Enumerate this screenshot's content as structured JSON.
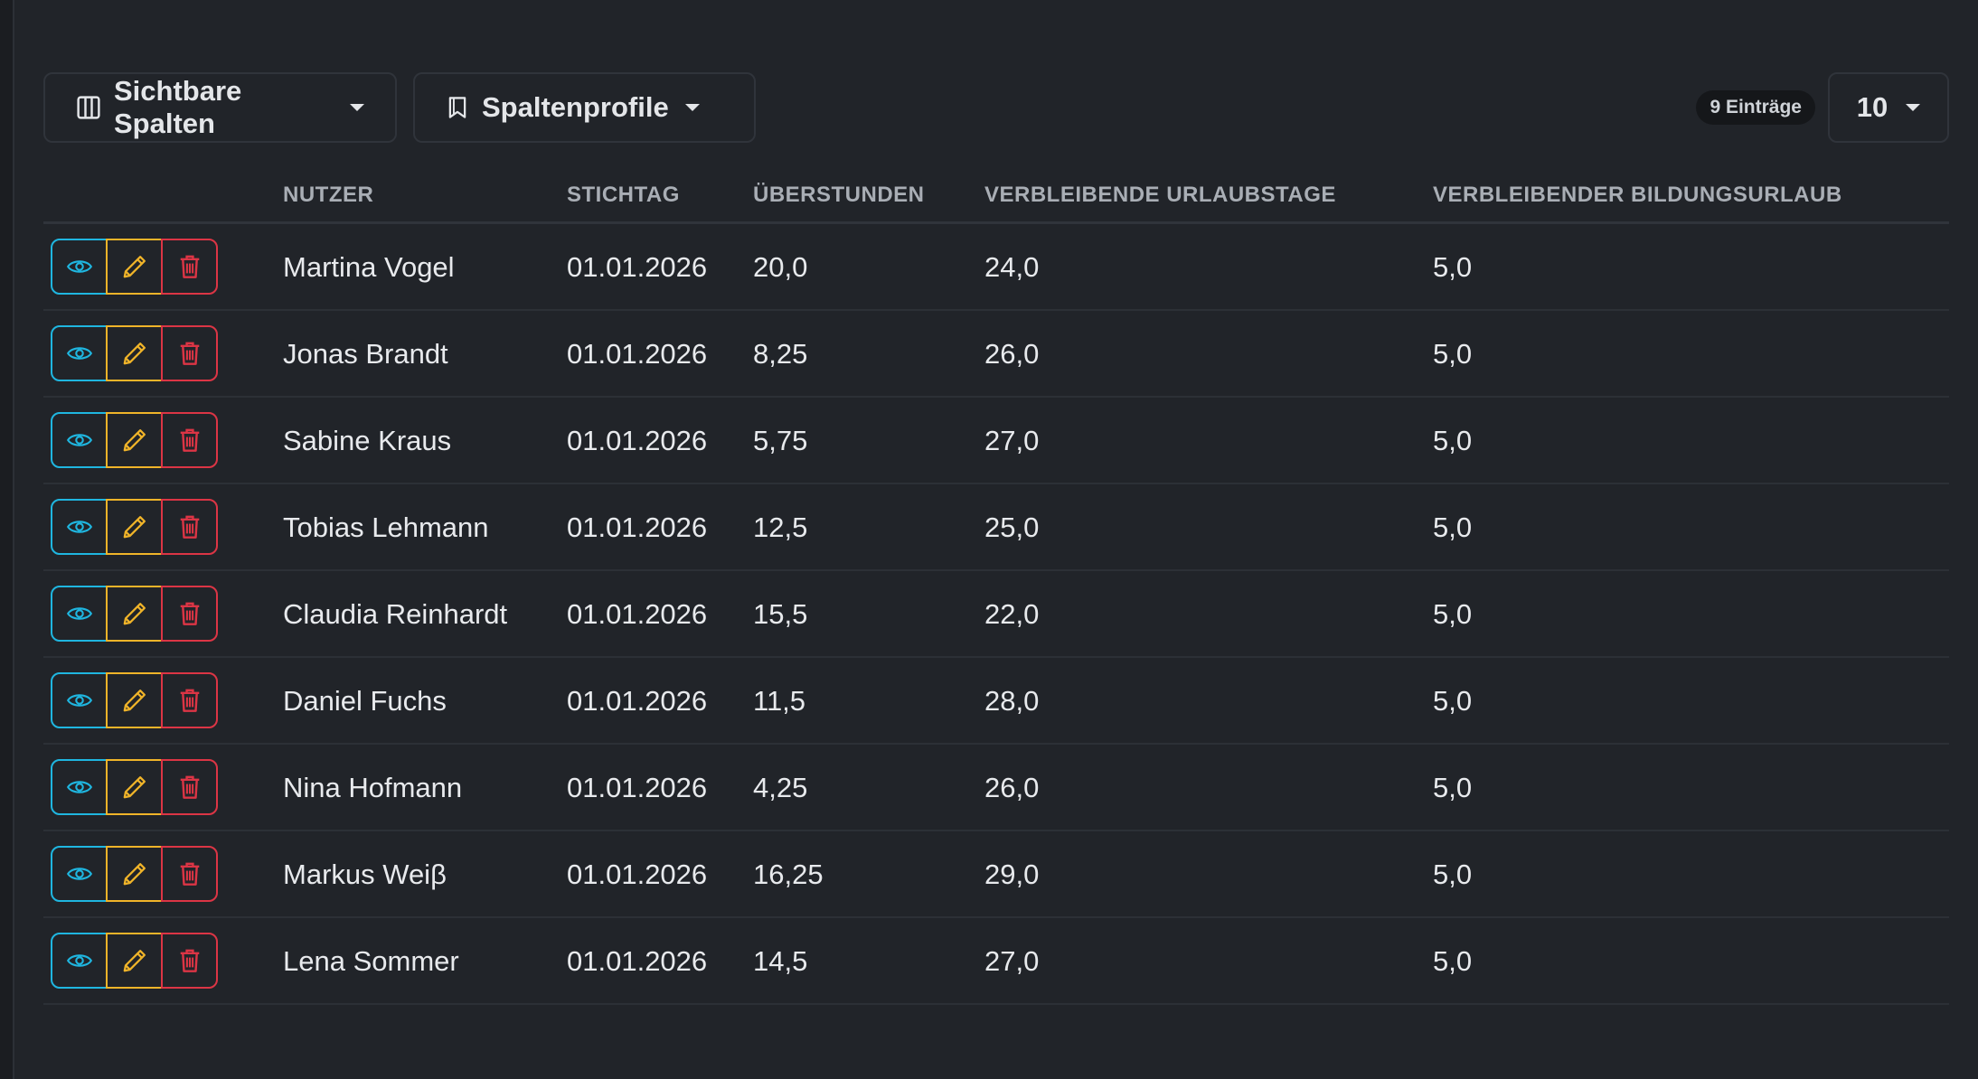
{
  "toolbar": {
    "columns_label": "Sichtbare Spalten",
    "columns_icon": "columns-icon",
    "profiles_label": "Spaltenprofile",
    "profiles_icon": "bookmark-icon",
    "entries_badge": "9 Einträge",
    "per_page": "10"
  },
  "table": {
    "headers": {
      "user": "NUTZER",
      "date": "STICHTAG",
      "overtime": "ÜBERSTUNDEN",
      "vacation": "VERBLEIBENDE URLAUBSTAGE",
      "education": "VERBLEIBENDER BILDUNGSURLAUB"
    },
    "action_icons": [
      "eye-icon",
      "pencil-icon",
      "trash-icon"
    ],
    "rows": [
      {
        "user": "Martina Vogel",
        "date": "01.01.2026",
        "overtime": "20,0",
        "vacation": "24,0",
        "education": "5,0"
      },
      {
        "user": "Jonas Brandt",
        "date": "01.01.2026",
        "overtime": "8,25",
        "vacation": "26,0",
        "education": "5,0"
      },
      {
        "user": "Sabine Kraus",
        "date": "01.01.2026",
        "overtime": "5,75",
        "vacation": "27,0",
        "education": "5,0"
      },
      {
        "user": "Tobias Lehmann",
        "date": "01.01.2026",
        "overtime": "12,5",
        "vacation": "25,0",
        "education": "5,0"
      },
      {
        "user": "Claudia Reinhardt",
        "date": "01.01.2026",
        "overtime": "15,5",
        "vacation": "22,0",
        "education": "5,0"
      },
      {
        "user": "Daniel Fuchs",
        "date": "01.01.2026",
        "overtime": "11,5",
        "vacation": "28,0",
        "education": "5,0"
      },
      {
        "user": "Nina Hofmann",
        "date": "01.01.2026",
        "overtime": "4,25",
        "vacation": "26,0",
        "education": "5,0"
      },
      {
        "user": "Markus Weiβ",
        "date": "01.01.2026",
        "overtime": "16,25",
        "vacation": "29,0",
        "education": "5,0"
      },
      {
        "user": "Lena Sommer",
        "date": "01.01.2026",
        "overtime": "14,5",
        "vacation": "27,0",
        "education": "5,0"
      }
    ]
  },
  "colors": {
    "background": "#212429",
    "view": "#1fb6e0",
    "edit": "#f0b429",
    "delete": "#dc3545"
  }
}
